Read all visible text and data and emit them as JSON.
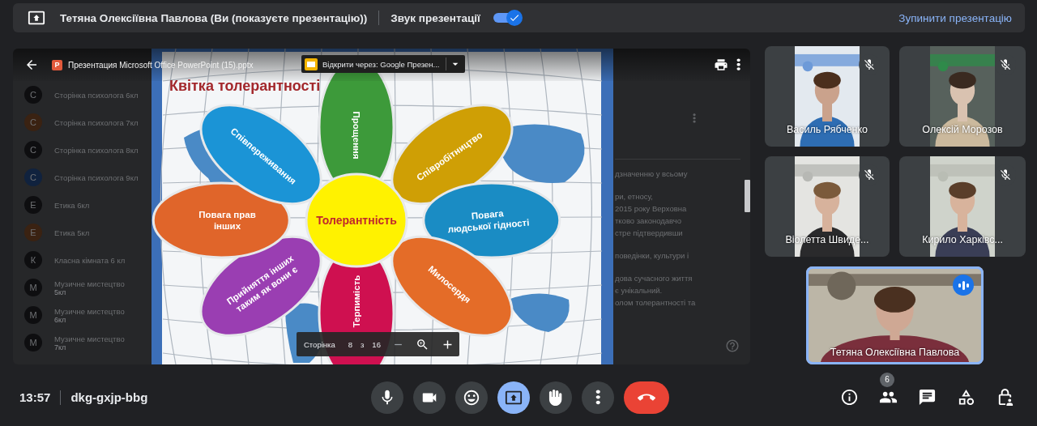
{
  "top_bar": {
    "presenter_text": "Тетяна Олексіївна Павлова (Ви (показуєте презентацію))",
    "presentation_audio": {
      "label": "Звук презентації",
      "on": true
    },
    "stop_link": "Зупинити презентацію"
  },
  "viewer": {
    "file_icon_letter": "P",
    "file_name": "Презентация Microsoft Office PowerPoint (15).pptx",
    "open_with": "Відкрити через: Google Презен...",
    "document_list": [
      {
        "letter": "С",
        "color": "#0e0e10",
        "title": "Сторінка психолога 6кл"
      },
      {
        "letter": "С",
        "color": "#3a2212",
        "title": "Сторінка психолога 7кл"
      },
      {
        "letter": "С",
        "color": "#0e0e10",
        "title": "Сторінка психолога 8кл"
      },
      {
        "letter": "С",
        "color": "#10223e",
        "title": "Сторінка психолога 9кл"
      },
      {
        "letter": "Е",
        "color": "#0e0e10",
        "title": "Етика 6кл"
      },
      {
        "letter": "Е",
        "color": "#3a2212",
        "title": "Етика 5кл"
      },
      {
        "letter": "К",
        "color": "#0e0e10",
        "title": "Класна кімната 6 кл"
      },
      {
        "letter": "М",
        "color": "#0e0e10",
        "title": "Музичне мистецтво",
        "subtitle": "5кл"
      },
      {
        "letter": "М",
        "color": "#0e0e10",
        "title": "Музичне мистецтво",
        "subtitle": "6кл"
      },
      {
        "letter": "М",
        "color": "#0e0e10",
        "title": "Музичне мистецтво",
        "subtitle": "7кл"
      }
    ],
    "side_text": [
      [
        "дзначенню у всьому"
      ],
      [
        "ри, етносу,",
        "2015 року Верховна",
        "тково законодавчо",
        "стре підтвердивши"
      ],
      [
        "поведінки, культури і"
      ],
      [
        "дова сучасного життя",
        "є унікальний.",
        "олом толерантності та"
      ]
    ],
    "slide": {
      "title": "Квітка толерантності",
      "center": "Толерантність",
      "petals": [
        {
          "lines": [
            "Прощення"
          ],
          "color": "#3d9a3a"
        },
        {
          "lines": [
            "Співробітництво"
          ],
          "color": "#cf9f05"
        },
        {
          "lines": [
            "Повага",
            "людської гідності"
          ],
          "color": "#1a8cc4"
        },
        {
          "lines": [
            "Милосердя"
          ],
          "color": "#e46c28"
        },
        {
          "lines": [
            "Терпимість"
          ],
          "color": "#cf1050"
        },
        {
          "lines": [
            "Прийняття інших",
            "таким як вони є"
          ],
          "color": "#9a3eb2"
        },
        {
          "lines": [
            "Повага прав",
            "інших"
          ],
          "color": "#e0652a"
        },
        {
          "lines": [
            "Співпереживання"
          ],
          "color": "#1b94d6"
        }
      ]
    },
    "page_controls": {
      "label": "Сторінка",
      "page": "8",
      "of": "з",
      "total": "16"
    }
  },
  "participants": [
    {
      "name": "Василь Рябченко",
      "muted": true,
      "speaking": false,
      "kind": "picture"
    },
    {
      "name": "Олексій Морозов",
      "muted": true,
      "speaking": false,
      "kind": "picture"
    },
    {
      "name": "Віолетта Швиде...",
      "muted": true,
      "speaking": false,
      "kind": "picture"
    },
    {
      "name": "Кирило Харківс...",
      "muted": true,
      "speaking": false,
      "kind": "picture"
    },
    {
      "name": "Тетяна Олексіївна Павлова",
      "muted": false,
      "speaking": true,
      "kind": "picture"
    }
  ],
  "bottom_bar": {
    "time": "13:57",
    "meeting_code": "dkg-gxjp-bbg",
    "controls": [
      {
        "kind": "microphone",
        "on": false
      },
      {
        "kind": "camera",
        "on": false
      },
      {
        "kind": "reactions",
        "on": false
      },
      {
        "kind": "present",
        "on": true
      },
      {
        "kind": "raise-hand",
        "on": false
      },
      {
        "kind": "more",
        "on": false
      },
      {
        "kind": "leave",
        "on": false
      }
    ],
    "side_controls": [
      {
        "kind": "info"
      },
      {
        "kind": "people",
        "badge": "6"
      },
      {
        "kind": "chat"
      },
      {
        "kind": "activities"
      },
      {
        "kind": "host-controls"
      }
    ]
  }
}
